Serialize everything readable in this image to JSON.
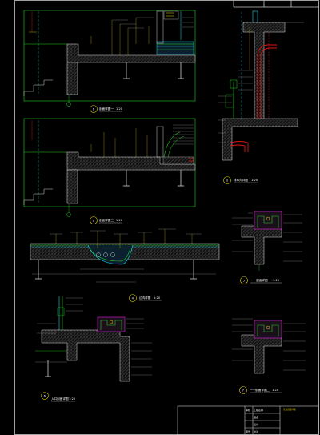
{
  "sheet": {
    "background": "#000000",
    "line_colors": {
      "frame": "#c8c8c8",
      "green": "#1fd11f",
      "cyan": "#15d8e8",
      "red": "#e01515",
      "magenta": "#e020e0",
      "yellow": "#e6d600",
      "hatch": "#9a9a9a"
    }
  },
  "details": [
    {
      "number": "1",
      "title": "剖面详图一",
      "scale": "1:20"
    },
    {
      "number": "2",
      "title": "剖面详图二",
      "scale": "1:20"
    },
    {
      "number": "3",
      "title": "排水沟详图",
      "scale": "1:20"
    },
    {
      "number": "4",
      "title": "边沟详图",
      "scale": "1:20"
    },
    {
      "number": "5",
      "title": "一一剖面详图一",
      "scale": "1:20"
    },
    {
      "number": "6",
      "title": "入口剖面详图",
      "scale": "1:20"
    },
    {
      "number": "7",
      "title": "一一剖面详图二",
      "scale": "1:20"
    }
  ],
  "title_block": {
    "rows": [
      "工程名称",
      "图名",
      "设计",
      "校对",
      "审核",
      "图号"
    ],
    "note": "景观剖面详图"
  }
}
